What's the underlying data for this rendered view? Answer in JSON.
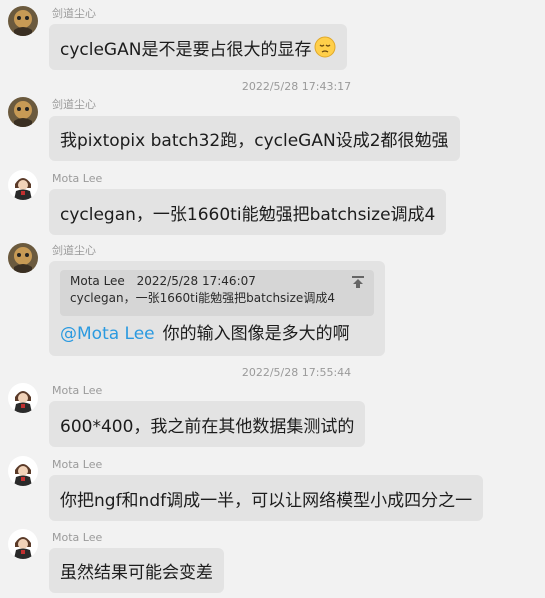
{
  "messages": [
    {
      "sender": "剑道尘心",
      "text": "cycleGAN是不是要占很大的显存",
      "emoji": "pensive-face-emoji"
    },
    {
      "sender": "剑道尘心",
      "text": "我pixtopix batch32跑，cycleGAN设成2都很勉强"
    },
    {
      "sender": "Mota Lee",
      "text": "cyclegan，一张1660ti能勉强把batchsize调成4"
    },
    {
      "sender": "剑道尘心",
      "quote": {
        "author": "Mota Lee",
        "time": "2022/5/28 17:46:07",
        "text": "cyclegan，一张1660ti能勉强把batchsize调成4"
      },
      "mention": "@Mota Lee",
      "text": "你的输入图像是多大的啊"
    },
    {
      "sender": "Mota Lee",
      "text": "600*400，我之前在其他数据集测试的"
    },
    {
      "sender": "Mota Lee",
      "text": "你把ngf和ndf调成一半，可以让网络模型小成四分之一"
    },
    {
      "sender": "Mota Lee",
      "text": "虽然结果可能会变差"
    }
  ],
  "timestamps": [
    "2022/5/28 17:43:17",
    "2022/5/28 17:55:44"
  ],
  "colors": {
    "background": "#f2f2f2",
    "bubble": "#e3e3e3",
    "quote": "#d6d6d6",
    "mention": "#2b9ae0",
    "meta_text": "#9a9a9a"
  }
}
